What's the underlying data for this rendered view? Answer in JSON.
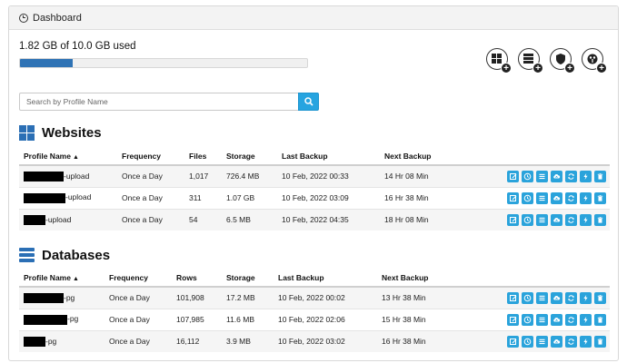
{
  "header": {
    "title": "Dashboard"
  },
  "usage": {
    "text": "1.82 GB of 10.0 GB used",
    "used_gb": 1.82,
    "total_gb": 10.0,
    "fraction": 0.182
  },
  "add_buttons": [
    {
      "icon": "add-website-icon"
    },
    {
      "icon": "add-database-icon"
    },
    {
      "icon": "add-security-icon"
    },
    {
      "icon": "add-dashboard-icon"
    }
  ],
  "search": {
    "placeholder": "Search by Profile Name",
    "value": ""
  },
  "websites": {
    "title": "Websites",
    "columns": [
      "Profile Name",
      "Frequency",
      "Files",
      "Storage",
      "Last Backup",
      "Next Backup"
    ],
    "rows": [
      {
        "name_suffix": "-upload",
        "frequency": "Once a Day",
        "count": "1,017",
        "storage": "726.4 MB",
        "last_backup": "10 Feb, 2022 00:33",
        "next_backup": "14 Hr 08 Min"
      },
      {
        "name_suffix": "-upload",
        "frequency": "Once a Day",
        "count": "311",
        "storage": "1.07 GB",
        "last_backup": "10 Feb, 2022 03:09",
        "next_backup": "16 Hr 38 Min"
      },
      {
        "name_suffix": "-upload",
        "frequency": "Once a Day",
        "count": "54",
        "storage": "6.5 MB",
        "last_backup": "10 Feb, 2022 04:35",
        "next_backup": "18 Hr 08 Min"
      }
    ]
  },
  "databases": {
    "title": "Databases",
    "columns": [
      "Profile Name",
      "Frequency",
      "Rows",
      "Storage",
      "Last Backup",
      "Next Backup"
    ],
    "rows": [
      {
        "name_suffix": "-pg",
        "frequency": "Once a Day",
        "count": "101,908",
        "storage": "17.2 MB",
        "last_backup": "10 Feb, 2022 00:02",
        "next_backup": "13 Hr 38 Min"
      },
      {
        "name_suffix": "-pg",
        "frequency": "Once a Day",
        "count": "107,985",
        "storage": "11.6 MB",
        "last_backup": "10 Feb, 2022 02:06",
        "next_backup": "15 Hr 38 Min"
      },
      {
        "name_suffix": "-pg",
        "frequency": "Once a Day",
        "count": "16,112",
        "storage": "3.9 MB",
        "last_backup": "10 Feb, 2022 03:02",
        "next_backup": "16 Hr 38 Min"
      }
    ]
  },
  "row_actions": [
    "edit-icon",
    "history-icon",
    "list-icon",
    "cloud-upload-icon",
    "refresh-icon",
    "bolt-icon",
    "trash-icon"
  ],
  "colors": {
    "accent": "#26a4e0",
    "progress": "#2f73b5",
    "action": "#2aa3db"
  }
}
